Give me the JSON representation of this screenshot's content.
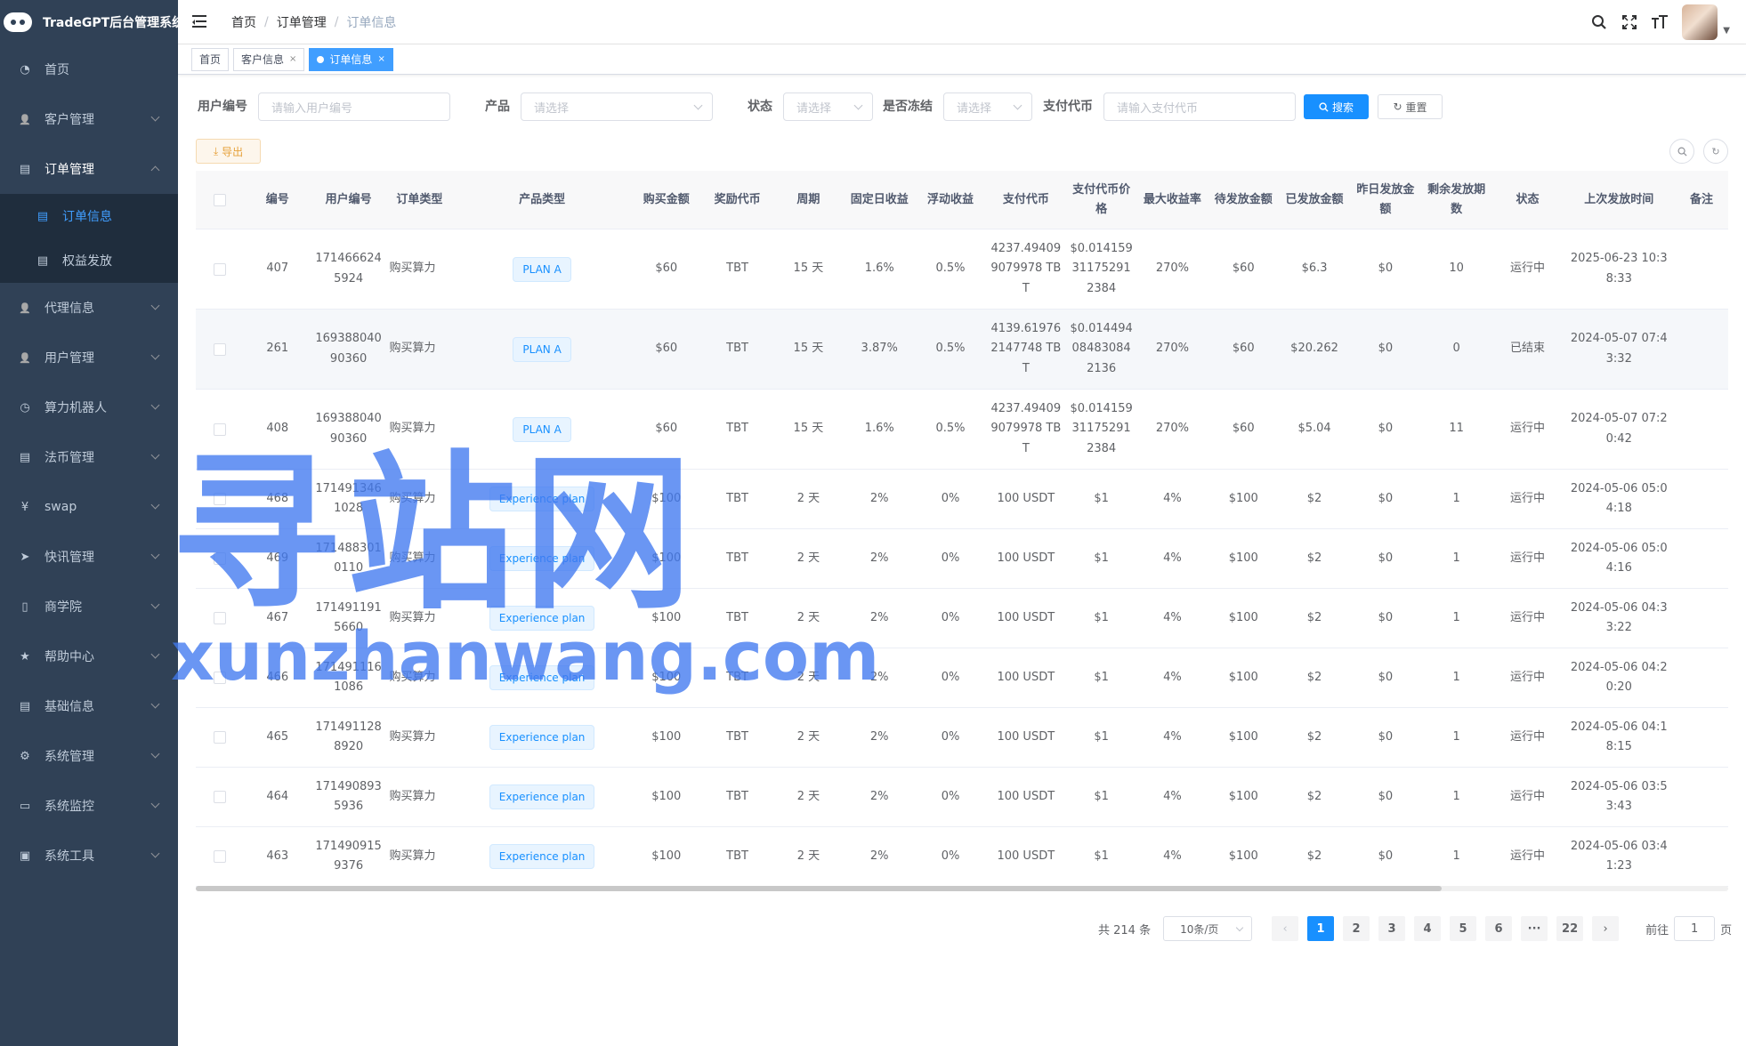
{
  "app": {
    "title": "TradeGPT后台管理系统"
  },
  "sidebar": {
    "items": [
      {
        "label": "首页",
        "icon": "dashboard-icon"
      },
      {
        "label": "客户管理",
        "icon": "user-icon"
      },
      {
        "label": "订单管理",
        "icon": "document-icon",
        "open": true,
        "children": [
          {
            "label": "订单信息",
            "icon": "document-icon",
            "active": true
          },
          {
            "label": "权益发放",
            "icon": "document-icon"
          }
        ]
      },
      {
        "label": "代理信息",
        "icon": "user-icon"
      },
      {
        "label": "用户管理",
        "icon": "user-icon"
      },
      {
        "label": "算力机器人",
        "icon": "clock-icon"
      },
      {
        "label": "法币管理",
        "icon": "document-icon"
      },
      {
        "label": "swap",
        "icon": "yen-icon"
      },
      {
        "label": "快讯管理",
        "icon": "send-icon"
      },
      {
        "label": "商学院",
        "icon": "book-icon"
      },
      {
        "label": "帮助中心",
        "icon": "star-icon"
      },
      {
        "label": "基础信息",
        "icon": "document-icon"
      },
      {
        "label": "系统管理",
        "icon": "gear-icon"
      },
      {
        "label": "系统监控",
        "icon": "monitor-icon"
      },
      {
        "label": "系统工具",
        "icon": "toolbox-icon"
      }
    ]
  },
  "navbar": {
    "breadcrumb": [
      "首页",
      "订单管理",
      "订单信息"
    ]
  },
  "tags": [
    {
      "label": "首页",
      "closable": false
    },
    {
      "label": "客户信息",
      "closable": true
    },
    {
      "label": "订单信息",
      "closable": true,
      "active": true
    }
  ],
  "search": {
    "user_id_label": "用户编号",
    "user_id_placeholder": "请输入用户编号",
    "product_label": "产品",
    "product_placeholder": "请选择",
    "status_label": "状态",
    "status_placeholder": "请选择",
    "frozen_label": "是否冻结",
    "frozen_placeholder": "请选择",
    "pay_coin_label": "支付代币",
    "pay_coin_placeholder": "请输入支付代币",
    "search_btn": "搜索",
    "reset_btn": "重置"
  },
  "toolbar": {
    "export_btn": "导出"
  },
  "table": {
    "columns": [
      "",
      "编号",
      "用户编号",
      "订单类型",
      "产品类型",
      "购买金额",
      "奖励代币",
      "周期",
      "固定日收益",
      "浮动收益",
      "支付代币",
      "支付代币价格",
      "最大收益率",
      "待发放金额",
      "已发放金额",
      "昨日发放金额",
      "剩余发放期数",
      "状态",
      "上次发放时间",
      "备注"
    ],
    "rows": [
      {
        "id": "407",
        "user": "1714666245924",
        "order_type": "购买算力",
        "product": "PLAN A",
        "amount": "$60",
        "reward": "TBT",
        "period": "15 天",
        "fixed": "1.6%",
        "float": "0.5%",
        "pay_coin": "4237.494099079978 TBT",
        "pay_price": "$0.014159311752912384",
        "max_rate": "270%",
        "pending": "$60",
        "paid": "$6.3",
        "yesterday": "$0",
        "remaining": "10",
        "status": "运行中",
        "last_time": "2025-06-23 10:38:33",
        "remark": ""
      },
      {
        "id": "261",
        "user": "16938804090360",
        "order_type": "购买算力",
        "product": "PLAN A",
        "amount": "$60",
        "reward": "TBT",
        "period": "15 天",
        "fixed": "3.87%",
        "float": "0.5%",
        "pay_coin": "4139.619762147748 TBT",
        "pay_price": "$0.014494084830842136",
        "max_rate": "270%",
        "pending": "$60",
        "paid": "$20.262",
        "yesterday": "$0",
        "remaining": "0",
        "status": "已结束",
        "last_time": "2024-05-07 07:43:32",
        "remark": ""
      },
      {
        "id": "408",
        "user": "16938804090360",
        "order_type": "购买算力",
        "product": "PLAN A",
        "amount": "$60",
        "reward": "TBT",
        "period": "15 天",
        "fixed": "1.6%",
        "float": "0.5%",
        "pay_coin": "4237.494099079978 TBT",
        "pay_price": "$0.014159311752912384",
        "max_rate": "270%",
        "pending": "$60",
        "paid": "$5.04",
        "yesterday": "$0",
        "remaining": "11",
        "status": "运行中",
        "last_time": "2024-05-07 07:20:42",
        "remark": ""
      },
      {
        "id": "468",
        "user": "1714913461028",
        "order_type": "购买算力",
        "product": "Experience plan",
        "amount": "$100",
        "reward": "TBT",
        "period": "2 天",
        "fixed": "2%",
        "float": "0%",
        "pay_coin": "100 USDT",
        "pay_price": "$1",
        "max_rate": "4%",
        "pending": "$100",
        "paid": "$2",
        "yesterday": "$0",
        "remaining": "1",
        "status": "运行中",
        "last_time": "2024-05-06 05:04:18",
        "remark": ""
      },
      {
        "id": "469",
        "user": "1714883010110",
        "order_type": "购买算力",
        "product": "Experience plan",
        "amount": "$100",
        "reward": "TBT",
        "period": "2 天",
        "fixed": "2%",
        "float": "0%",
        "pay_coin": "100 USDT",
        "pay_price": "$1",
        "max_rate": "4%",
        "pending": "$100",
        "paid": "$2",
        "yesterday": "$0",
        "remaining": "1",
        "status": "运行中",
        "last_time": "2024-05-06 05:04:16",
        "remark": ""
      },
      {
        "id": "467",
        "user": "1714911915660",
        "order_type": "购买算力",
        "product": "Experience plan",
        "amount": "$100",
        "reward": "TBT",
        "period": "2 天",
        "fixed": "2%",
        "float": "0%",
        "pay_coin": "100 USDT",
        "pay_price": "$1",
        "max_rate": "4%",
        "pending": "$100",
        "paid": "$2",
        "yesterday": "$0",
        "remaining": "1",
        "status": "运行中",
        "last_time": "2024-05-06 04:33:22",
        "remark": ""
      },
      {
        "id": "466",
        "user": "1714911161086",
        "order_type": "购买算力",
        "product": "Experience plan",
        "amount": "$100",
        "reward": "TBT",
        "period": "2 天",
        "fixed": "2%",
        "float": "0%",
        "pay_coin": "100 USDT",
        "pay_price": "$1",
        "max_rate": "4%",
        "pending": "$100",
        "paid": "$2",
        "yesterday": "$0",
        "remaining": "1",
        "status": "运行中",
        "last_time": "2024-05-06 04:20:20",
        "remark": ""
      },
      {
        "id": "465",
        "user": "1714911288920",
        "order_type": "购买算力",
        "product": "Experience plan",
        "amount": "$100",
        "reward": "TBT",
        "period": "2 天",
        "fixed": "2%",
        "float": "0%",
        "pay_coin": "100 USDT",
        "pay_price": "$1",
        "max_rate": "4%",
        "pending": "$100",
        "paid": "$2",
        "yesterday": "$0",
        "remaining": "1",
        "status": "运行中",
        "last_time": "2024-05-06 04:18:15",
        "remark": ""
      },
      {
        "id": "464",
        "user": "1714908935936",
        "order_type": "购买算力",
        "product": "Experience plan",
        "amount": "$100",
        "reward": "TBT",
        "period": "2 天",
        "fixed": "2%",
        "float": "0%",
        "pay_coin": "100 USDT",
        "pay_price": "$1",
        "max_rate": "4%",
        "pending": "$100",
        "paid": "$2",
        "yesterday": "$0",
        "remaining": "1",
        "status": "运行中",
        "last_time": "2024-05-06 03:53:43",
        "remark": ""
      },
      {
        "id": "463",
        "user": "1714909159376",
        "order_type": "购买算力",
        "product": "Experience plan",
        "amount": "$100",
        "reward": "TBT",
        "period": "2 天",
        "fixed": "2%",
        "float": "0%",
        "pay_coin": "100 USDT",
        "pay_price": "$1",
        "max_rate": "4%",
        "pending": "$100",
        "paid": "$2",
        "yesterday": "$0",
        "remaining": "1",
        "status": "运行中",
        "last_time": "2024-05-06 03:41:23",
        "remark": ""
      }
    ]
  },
  "pagination": {
    "total": "共 214 条",
    "page_size": "10条/页",
    "pages": [
      "1",
      "2",
      "3",
      "4",
      "5",
      "6",
      "···",
      "22"
    ],
    "current": "1",
    "goto_label": "前往",
    "goto_value": "1",
    "page_unit": "页"
  },
  "watermark": {
    "line1": "寻站网",
    "line2": "xunzhanwang.com"
  },
  "colors": {
    "primary": "#1890ff",
    "sidebar_bg": "#304156",
    "submenu_bg": "#1f2d3d",
    "warning": "#e6a23c"
  }
}
